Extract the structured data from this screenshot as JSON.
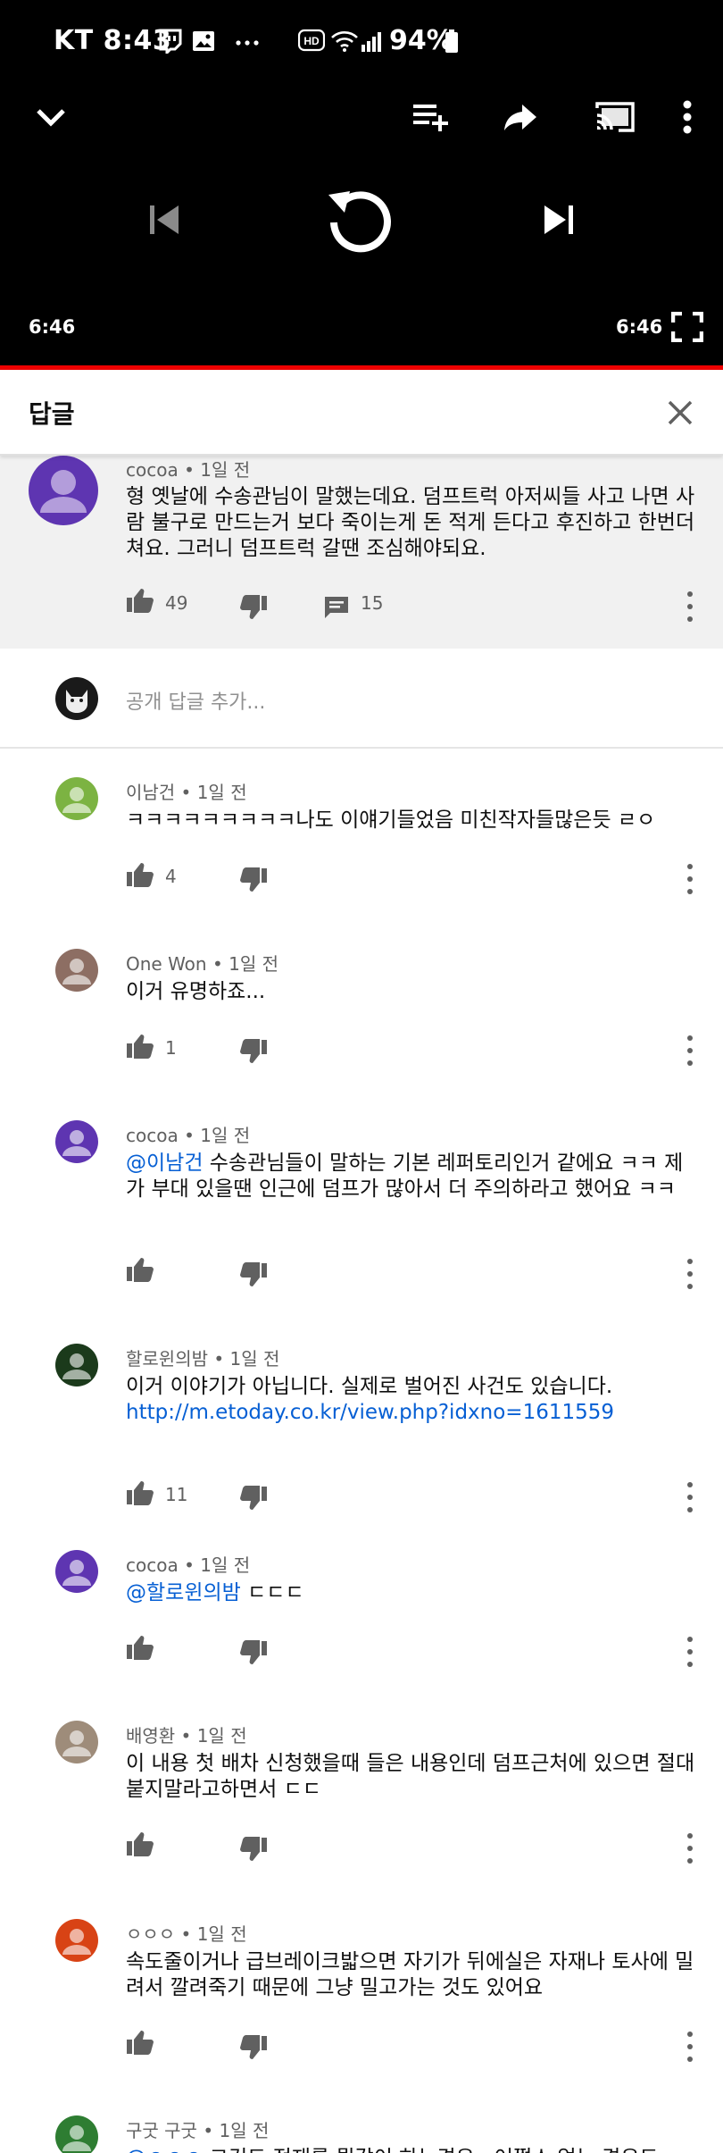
{
  "status_bar": {
    "carrier_time": "KT 8:43",
    "battery": "94%"
  },
  "player": {
    "current_time": "6:46",
    "duration": "6:46"
  },
  "header": {
    "title": "답글"
  },
  "parent_comment": {
    "meta": "cocoa • 1일 전",
    "text": "형 옛날에 수송관님이 말했는데요. 덤프트럭 아저씨들 사고 나면 사람 불구로 만드는거 보다 죽이는게 돈 적게 든다고 후진하고 한번더 쳐요. 그러니 덤프트럭 갈땐 조심해야되요.",
    "likes": "49",
    "reply_count": "15"
  },
  "add_reply": {
    "placeholder": "공개 답글 추가..."
  },
  "replies": [
    {
      "meta": "이남건 • 1일 전",
      "mention": "",
      "text": "ㅋㅋㅋㅋㅋㅋㅋㅋㅋ나도 이얘기들었음 미친작자들많은듯 ㄹㅇ",
      "link": "",
      "likes": "4",
      "avatar_color": "#7cb342"
    },
    {
      "meta": "One Won • 1일 전",
      "mention": "",
      "text": "이거 유명하죠...",
      "link": "",
      "likes": "1",
      "avatar_color": "#8d6e63"
    },
    {
      "meta": "cocoa • 1일 전",
      "mention": "@이남건",
      "text": " 수송관님들이 말하는 기본 레퍼토리인거 같에요 ㅋㅋ 제가 부대 있을땐 인근에 덤프가 많아서 더 주의하라고 했어요 ㅋㅋ",
      "link": "",
      "likes": "",
      "avatar_color": "#5e35b1"
    },
    {
      "meta": "할로윈의밤 • 1일 전",
      "mention": "",
      "text": "이거 이야기가 아닙니다. 실제로 벌어진 사건도 있습니다.",
      "link": "http://m.etoday.co.kr/view.php?idxno=1611559",
      "likes": "11",
      "avatar_color": "#1b3a1b"
    },
    {
      "meta": "cocoa • 1일 전",
      "mention": "@할로윈의밤",
      "text": " ㄷㄷㄷ",
      "link": "",
      "likes": "",
      "avatar_color": "#5e35b1"
    },
    {
      "meta": "배영환 • 1일 전",
      "mention": "",
      "text": "이 내용 첫 배차 신청했을때 들은 내용인데 덤프근처에 있으면 절대 붙지말라고하면서  ㄷㄷ",
      "link": "",
      "likes": "",
      "avatar_color": "#9e8c7a"
    },
    {
      "meta": "ㅇㅇㅇ • 1일 전",
      "mention": "",
      "text": "속도줄이거나 급브레이크밟으면 자기가 뒤에실은 자재나 토사에 밀려서 깔려죽기 때문에 그냥 밀고가는 것도 있어요",
      "link": "",
      "likes": "",
      "avatar_color": "#d84315"
    },
    {
      "meta": "구굿 구굿 • 1일 전",
      "mention": "@ㅇㅇㅇ",
      "text": " 그것도 적재를 뭘갈이 하는경우.. 어쩔스 없는 경우도",
      "link": "",
      "likes": "",
      "avatar_color": "#2e7d32"
    }
  ]
}
